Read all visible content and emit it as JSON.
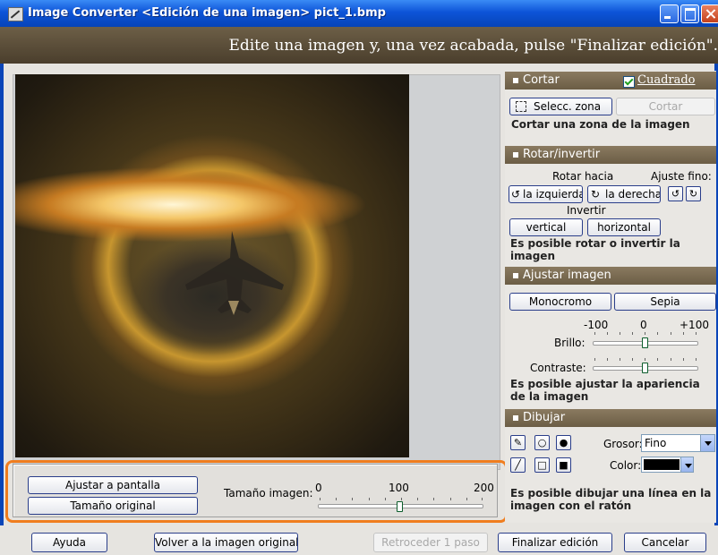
{
  "window": {
    "title": "Image Converter <Edición de una imagen> pict_1.bmp"
  },
  "instruction": "Edite una imagen y, una vez acabada, pulse \"Finalizar edición\".",
  "image_panel": {
    "fit_button": "Ajustar a pantalla",
    "original_size_button": "Tamaño original",
    "size_label": "Tamaño imagen:",
    "size_min": "0",
    "size_mid": "100",
    "size_max": "200",
    "size_value": 100
  },
  "crop": {
    "title": "Cortar",
    "square_label": "Cuadrado",
    "square_checked": true,
    "select_zone_button": "Selecc. zona",
    "cut_button": "Cortar",
    "description": "Cortar una zona de la imagen"
  },
  "rotate": {
    "title": "Rotar/invertir",
    "rotate_label": "Rotar hacia",
    "fine_label": "Ajuste fino:",
    "left_button": "la izquierda",
    "right_button": "la derecha",
    "invert_label": "Invertir",
    "vertical_button": "vertical",
    "horizontal_button": "horizontal",
    "description": "Es posible rotar o invertir la imagen"
  },
  "adjust": {
    "title": "Ajustar imagen",
    "mono_button": "Monocromo",
    "sepia_button": "Sepia",
    "scale_min": "-100",
    "scale_mid": "0",
    "scale_max": "+100",
    "brightness_label": "Brillo:",
    "brightness_value": 0,
    "contrast_label": "Contraste:",
    "contrast_value": 0,
    "description": "Es posible ajustar la apariencia de la imagen"
  },
  "draw": {
    "title": "Dibujar",
    "thickness_label": "Grosor:",
    "thickness_value": "Fino",
    "color_label": "Color:",
    "color_value": "#000000",
    "description": "Es posible dibujar una línea en la imagen con el ratón"
  },
  "footer": {
    "help_button": "Ayuda",
    "revert_button": "Volver a la imagen original",
    "undo_button": "Retroceder 1 paso",
    "finish_button": "Finalizar edición",
    "cancel_button": "Cancelar"
  },
  "colors": {
    "title_bar": "#0d54d8",
    "section_header": "#7a6b52",
    "highlight_outline": "#f07d1e"
  }
}
